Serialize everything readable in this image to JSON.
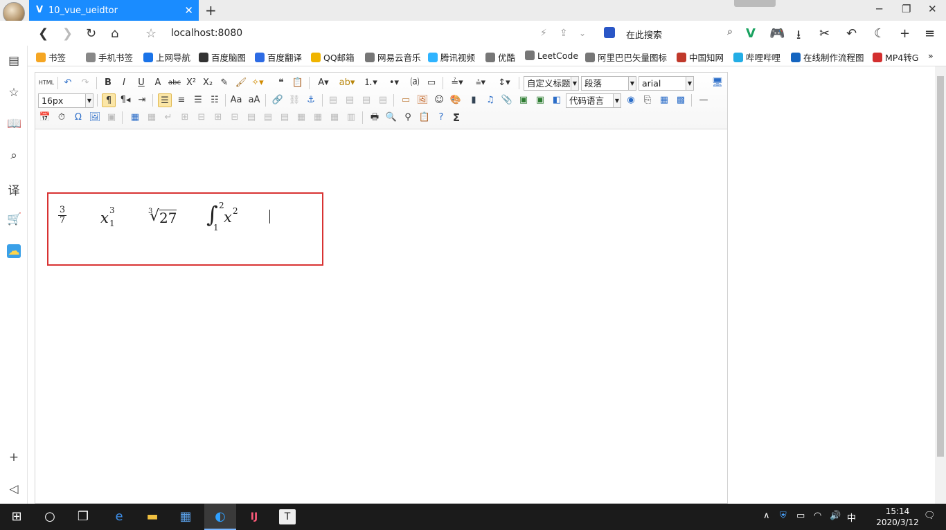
{
  "tab": {
    "title": "10_vue_ueidtor"
  },
  "address": {
    "url": "localhost:8080"
  },
  "search": {
    "placeholder": "在此搜索"
  },
  "bookmarks": [
    {
      "label": "书签",
      "color": "#f5a623"
    },
    {
      "label": "手机书签",
      "color": "#888888"
    },
    {
      "label": "上网导航",
      "color": "#1a73e8"
    },
    {
      "label": "百度脑图",
      "color": "#333333"
    },
    {
      "label": "百度翻译",
      "color": "#2d6be4"
    },
    {
      "label": "QQ邮箱",
      "color": "#f0b400"
    },
    {
      "label": "网易云音乐",
      "color": "#777777"
    },
    {
      "label": "腾讯视频",
      "color": "#2fb4ff"
    },
    {
      "label": "优酷",
      "color": "#777777"
    },
    {
      "label": "LeetCode",
      "color": "#777777"
    },
    {
      "label": "阿里巴巴矢量图标",
      "color": "#777777"
    },
    {
      "label": "中国知网",
      "color": "#c0392b"
    },
    {
      "label": "哔哩哔哩",
      "color": "#23ade5"
    },
    {
      "label": "在线制作流程图",
      "color": "#1565c0"
    },
    {
      "label": "MP4转G",
      "color": "#d32f2f"
    }
  ],
  "toolbar": {
    "source_label": "HTML",
    "heading_select": "自定义标题",
    "paragraph_select": "段落",
    "font_select": "arial",
    "fontsize_select": "16px",
    "code_select": "代码语言"
  },
  "math": {
    "frac_num": "3",
    "frac_den": "7",
    "sub_base": "x",
    "sub_sup": "3",
    "sub_sub": "1",
    "root_index": "3",
    "root_body": "27",
    "int_upper": "2",
    "int_lower": "1",
    "int_body": "x",
    "int_pow": "2"
  },
  "taskbar": {
    "time": "15:14",
    "date": "2020/3/12",
    "ime": "中"
  }
}
